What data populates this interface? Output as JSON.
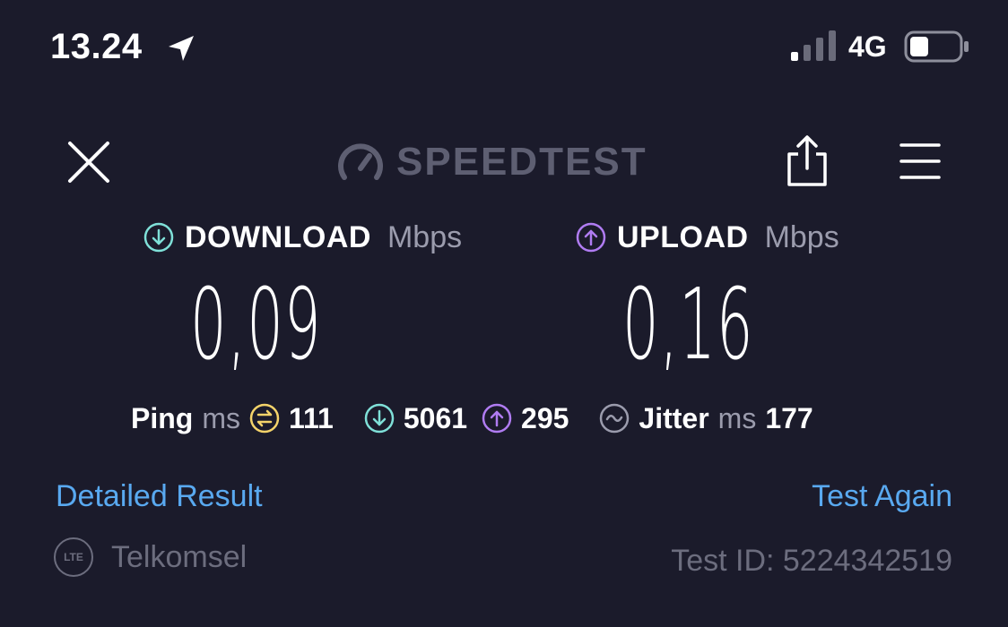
{
  "status_bar": {
    "time": "13.24",
    "network_type": "4G",
    "icons": [
      "location-arrow-icon",
      "signal-icon",
      "battery-icon"
    ]
  },
  "header": {
    "brand": "SPEEDTEST",
    "icons": [
      "close-icon",
      "speedometer-icon",
      "share-icon",
      "menu-icon"
    ]
  },
  "download": {
    "label": "DOWNLOAD",
    "unit": "Mbps",
    "value": "0,09",
    "color": "#7fe0d8"
  },
  "upload": {
    "label": "UPLOAD",
    "unit": "Mbps",
    "value": "0,16",
    "color": "#b07cf2"
  },
  "ping": {
    "label": "Ping",
    "unit": "ms",
    "idle": "111",
    "download": "5061",
    "upload": "295",
    "idle_color": "#f4d36a"
  },
  "jitter": {
    "label": "Jitter",
    "unit": "ms",
    "value": "177"
  },
  "links": {
    "detailed": "Detailed Result",
    "again": "Test Again"
  },
  "footer": {
    "badge": "LTE",
    "provider": "Telkomsel",
    "test_id": "Test ID: 5224342519"
  },
  "colors": {
    "background": "#1b1b2b",
    "link": "#59a9f0",
    "muted": "#6c6d7e"
  }
}
